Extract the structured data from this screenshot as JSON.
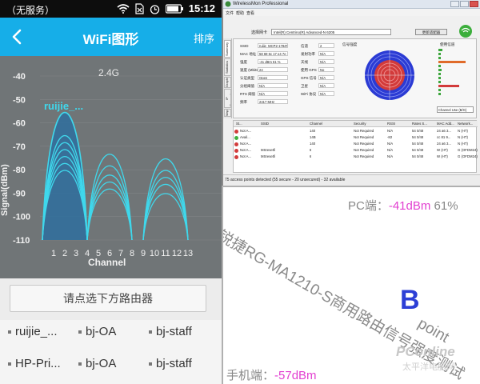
{
  "phone": {
    "status_bar": {
      "carrier": "（无服务）",
      "time": "15:12",
      "icons": [
        "wifi-icon",
        "no-sim-icon",
        "alarm-icon",
        "battery-icon"
      ]
    },
    "app_bar": {
      "title": "WiFi图形",
      "action": "排序",
      "back_icon": "back-chevron-icon"
    },
    "graph": {
      "band_label": "2.4G",
      "selected_ssid_label": "ruijie_..."
    },
    "select_button": "请点选下方路由器",
    "networks": [
      "ruijie_...",
      "bj-OA",
      "bj-staff",
      "HP-Pri...",
      "bj-OA",
      "bj-staff"
    ]
  },
  "chart_data": {
    "type": "line",
    "xlabel": "Channel",
    "ylabel": "Signal(dBm)",
    "x_ticks": [
      1,
      2,
      3,
      4,
      5,
      6,
      7,
      8,
      9,
      10,
      11,
      12,
      13
    ],
    "y_ticks": [
      -40,
      -50,
      -60,
      -70,
      -80,
      -90,
      -100,
      -110
    ],
    "ylim": [
      -110,
      -36
    ],
    "annotation": "2.4G",
    "series": [
      {
        "name": "ruijie_...",
        "center_channel": 2,
        "peak_dbm": -55,
        "selected": true
      },
      {
        "center_channel": 2,
        "peak_dbm": -65
      },
      {
        "center_channel": 2,
        "peak_dbm": -68
      },
      {
        "center_channel": 2,
        "peak_dbm": -71
      },
      {
        "center_channel": 2,
        "peak_dbm": -74
      },
      {
        "center_channel": 2,
        "peak_dbm": -77
      },
      {
        "center_channel": 2,
        "peak_dbm": -80
      },
      {
        "center_channel": 6,
        "peak_dbm": -73
      },
      {
        "center_channel": 6,
        "peak_dbm": -78
      },
      {
        "center_channel": 6,
        "peak_dbm": -82
      },
      {
        "center_channel": 6,
        "peak_dbm": -85
      },
      {
        "center_channel": 6,
        "peak_dbm": -88
      },
      {
        "center_channel": 11,
        "peak_dbm": -75
      },
      {
        "center_channel": 11,
        "peak_dbm": -80
      },
      {
        "center_channel": 11,
        "peak_dbm": -83
      },
      {
        "center_channel": 11,
        "peak_dbm": -86
      },
      {
        "center_channel": 11,
        "peak_dbm": -90
      }
    ],
    "colors": {
      "line": "#3fd8ec",
      "selected_fill": "#2e6f9e",
      "label": "#3fd8ec",
      "background": "#707577"
    }
  },
  "pc_window": {
    "title": "WirelessMon Professional",
    "menu": [
      "文件",
      "帮助",
      "查看"
    ],
    "adapter_label": "选择网卡",
    "adapter_value": "Intel(R) Centrino(R) Advanced-N 6205",
    "update_button": "更新适配器",
    "tabs": [
      "Summary",
      "Statistics",
      "Graphs",
      "IP Connection",
      "Map"
    ],
    "left_fields": [
      {
        "k": "SSID",
        "v": "ruijie_MCP2-1784TE"
      },
      {
        "k": "MAC 地址",
        "v": "58 69 6c 17 e4 7e"
      },
      {
        "k": "强度",
        "v": "-41 dBm   61 %"
      },
      {
        "k": "速度 (Mbits)",
        "v": "24"
      },
      {
        "k": "认证类型",
        "v": "Open"
      },
      {
        "k": "分组阈值",
        "v": "N/A"
      },
      {
        "k": "RTS 阈值",
        "v": "N/A"
      },
      {
        "k": "频率",
        "v": "2417 MHz"
      }
    ],
    "mid_fields": [
      {
        "k": "信道",
        "v": "2"
      },
      {
        "k": "发射功率",
        "v": "N/A"
      },
      {
        "k": "天线",
        "v": "N/A"
      },
      {
        "k": "使用 GPS",
        "v": "No"
      },
      {
        "k": "GPS 信号",
        "v": "N/A"
      },
      {
        "k": "卫星",
        "v": "N/A"
      },
      {
        "k": "WiFi 协议",
        "v": "N/A"
      }
    ],
    "signal_strength_label": "信号强度",
    "channel_usage_label": "使用信道",
    "channel_usage_select": "Channel Use (B/G)",
    "table_headers": [
      "St...",
      "SSID",
      "Channel",
      "Security",
      "RSSI",
      "Rates S...",
      "MAC Add...",
      "Network..."
    ],
    "table_rows": [
      [
        "Not A...",
        "",
        "140",
        "Not Required",
        "N/A",
        "54 0/48",
        "24 a6 3...",
        "N (HT)"
      ],
      [
        "Avail...",
        "",
        "14B",
        "Not Required",
        "-82",
        "54 0/48",
        "cc 81 9...",
        "N (HT)"
      ],
      [
        "Not A...",
        "",
        "140",
        "Not Required",
        "N/A",
        "54 0/48",
        "24 a6 3...",
        "N (HT)"
      ],
      [
        "Not A...",
        "MSresetfi",
        "6",
        "Not Required",
        "N/A",
        "54 0/48",
        "W (HT)",
        "G (OFDM24)"
      ],
      [
        "Not A...",
        "MSresetfi",
        "6",
        "Not Required",
        "N/A",
        "54 0/48",
        "W (HT)",
        "G (OFDM24)"
      ]
    ],
    "status_text": "75 access points detected (55 secure - 20 unsecured) - 32 available"
  },
  "overlay": {
    "pc_prefix": "PC端：",
    "pc_dbm": "-41dBm",
    "pc_percent": "61%",
    "diagonal_text": "锐捷RG-MA1210-S商用路由信号强度测试",
    "point_letter": "B",
    "point_word": "point",
    "phone_prefix": "手机端：",
    "phone_dbm": "-57dBm",
    "watermark_brand": "PConline",
    "watermark_sub": "太平洋电脑网",
    "colors": {
      "magenta": "#e23fd0",
      "point_blue": "#2d3fd6",
      "gray_text": "#8a8a8a"
    }
  }
}
